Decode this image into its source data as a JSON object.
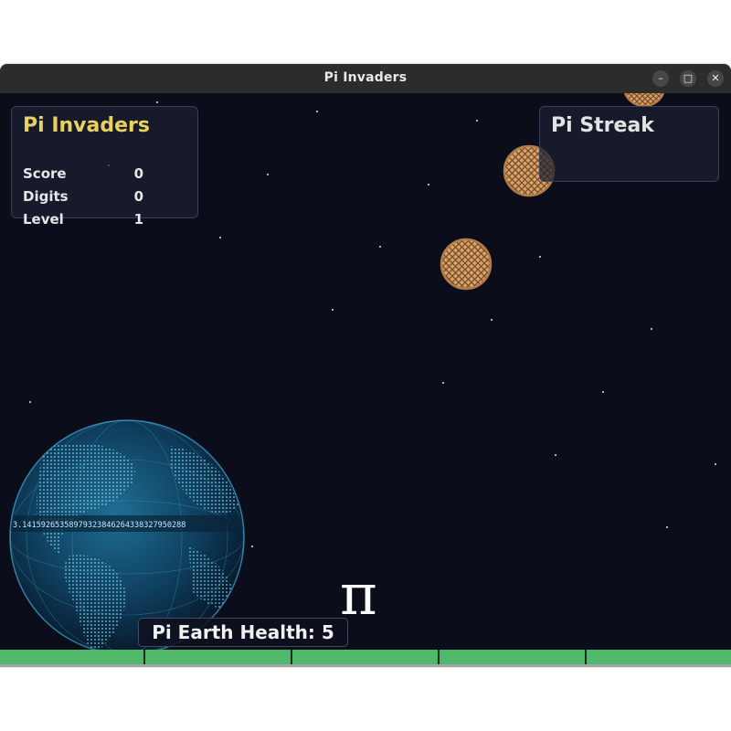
{
  "window": {
    "title": "Pi Invaders"
  },
  "window_controls": {
    "minimize": "–",
    "maximize": "□",
    "close": "✕"
  },
  "stats": {
    "title": "Pi Invaders",
    "rows": [
      {
        "label": "Score",
        "value": "0"
      },
      {
        "label": "Digits",
        "value": "0"
      },
      {
        "label": "Level",
        "value": "1"
      }
    ]
  },
  "streak": {
    "title": "Pi Streak"
  },
  "earth": {
    "digits_band": "3.14159265358979323846264338327950288"
  },
  "player": {
    "symbol": "π"
  },
  "health": {
    "label": "Pi Earth Health: 5",
    "value": 5,
    "max": 5
  },
  "colors": {
    "background": "#0b0d1b",
    "title_accent": "#e9d15f",
    "health_bar": "#4fb86a",
    "pie_crust": "#d3a06a"
  }
}
